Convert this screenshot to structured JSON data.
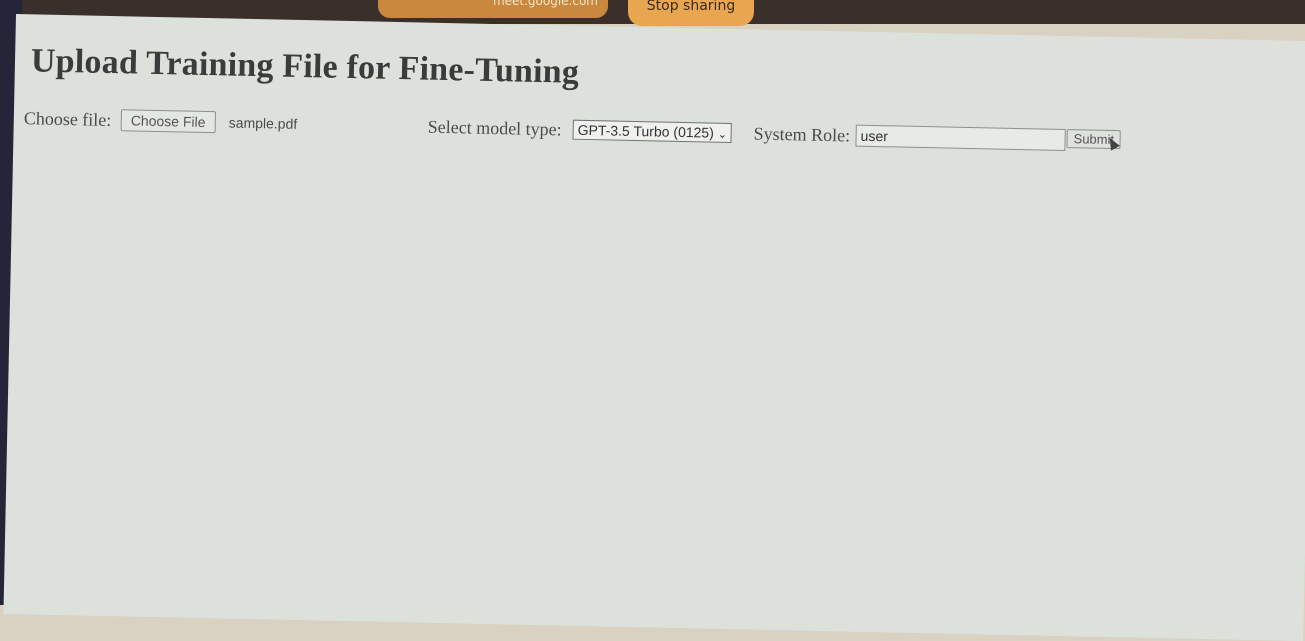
{
  "share_bar": {
    "url_text": "meet.google.com",
    "stop_label": "Stop sharing"
  },
  "page_title": "Upload Training File for Fine-Tuning",
  "form": {
    "file_label": "Choose file:",
    "file_button_label": "Choose File",
    "file_name": "sample.pdf",
    "model_label": "Select model type:",
    "model_selected": "GPT-3.5 Turbo (0125)",
    "role_label": "System Role:",
    "role_value": "user",
    "submit_label": "Submit"
  }
}
